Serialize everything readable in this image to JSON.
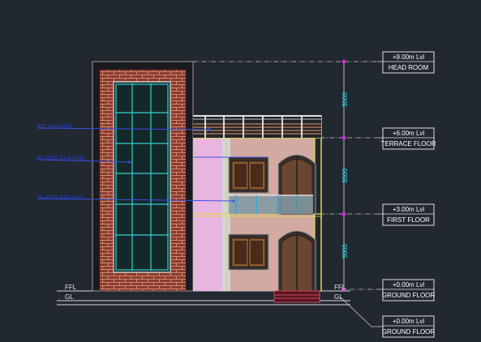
{
  "levels": [
    {
      "value": "+9.00m Lvl",
      "name": "HEAD ROOM"
    },
    {
      "value": "+6.00m Lvl",
      "name": "TERRACE FLOOR"
    },
    {
      "value": "+3.00m Lvl",
      "name": "FIRST FLOOR"
    },
    {
      "value": "+0.00m Lvl",
      "name": "GROUND FLOOR"
    },
    {
      "value": "+0.00m Lvl",
      "name": "GROUND FLOOR"
    }
  ],
  "dimensions": [
    "3000",
    "3000",
    "3000"
  ],
  "callouts": [
    "MS RAILING",
    "GLASS GLAZING",
    "GLASS RAILING"
  ],
  "ground_marks": {
    "ffl": "FFL",
    "gl": "GL"
  },
  "colors": {
    "background": "#212830",
    "brick": "#8e3a2c",
    "mortar": "#c88a72",
    "glazing_frame": "#33d2d2",
    "wall_pink": "#e8b4e0",
    "wall_tan": "#d2aaa2",
    "accent_yellow": "#e2d84a",
    "callout_text": "#2a3fd8",
    "dimension_text": "#2fe6f0",
    "level_marker": "#d42ad8"
  }
}
